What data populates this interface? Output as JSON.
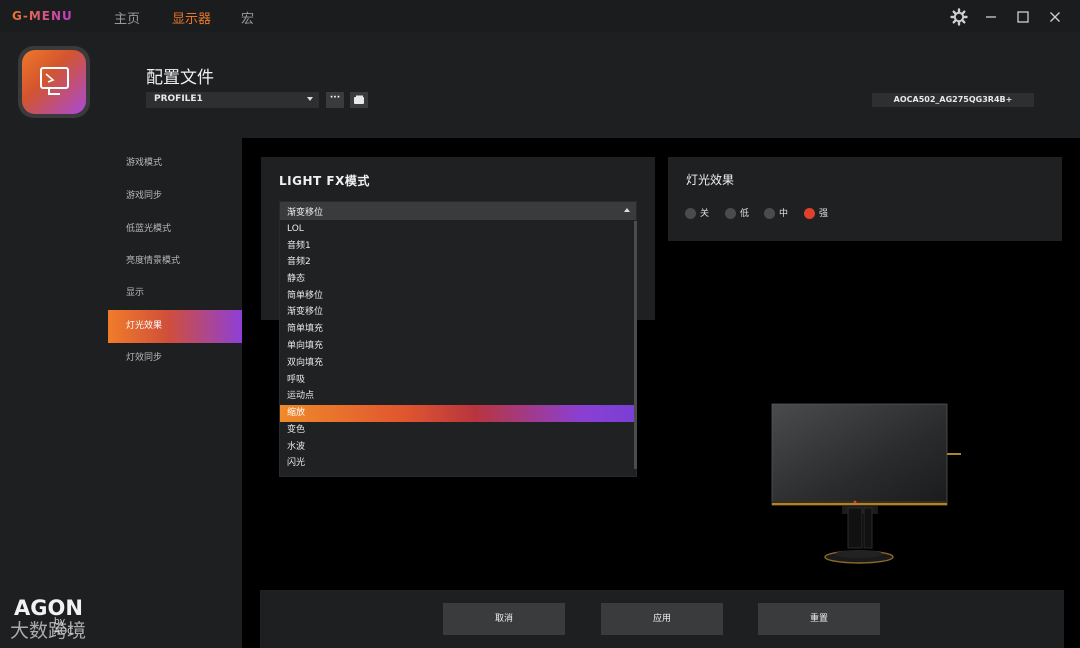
{
  "titlebar": {
    "app_name": "G-MENU",
    "nav": {
      "home": "主页",
      "display": "显示器",
      "macro": "宏"
    }
  },
  "brand": {
    "name": "AGON",
    "sub": "by AOC"
  },
  "header": {
    "profile_title": "配置文件",
    "profile_value": "PROFILE1",
    "more_label": "···",
    "device_id": "AOCA502_AG275QG3R4B+"
  },
  "sidemenu": {
    "items": [
      {
        "label": "游戏模式"
      },
      {
        "label": "游戏同步"
      },
      {
        "label": "低蓝光模式"
      },
      {
        "label": "亮度情景模式"
      },
      {
        "label": "显示"
      },
      {
        "label": "灯光效果"
      },
      {
        "label": "灯效同步"
      }
    ],
    "active_index": 5
  },
  "lightfx": {
    "title": "LIGHT FX模式",
    "selected": "渐变移位",
    "options": [
      "LOL",
      "音频1",
      "音频2",
      "静态",
      "简单移位",
      "渐变移位",
      "简单填充",
      "单向填充",
      "双向填充",
      "呼吸",
      "运动点",
      "缩放",
      "变色",
      "水波",
      "闪光"
    ],
    "highlighted": "缩放"
  },
  "effect": {
    "title": "灯光效果",
    "options": [
      "关",
      "低",
      "中",
      "强"
    ],
    "selected": "强"
  },
  "actions": {
    "cancel": "取消",
    "apply": "应用",
    "reset": "重置"
  },
  "watermark": "大数跨境",
  "colors": {
    "accent_orange": "#f07c2a",
    "accent_purple": "#8e3fd8",
    "radio_on": "#e0412c"
  }
}
